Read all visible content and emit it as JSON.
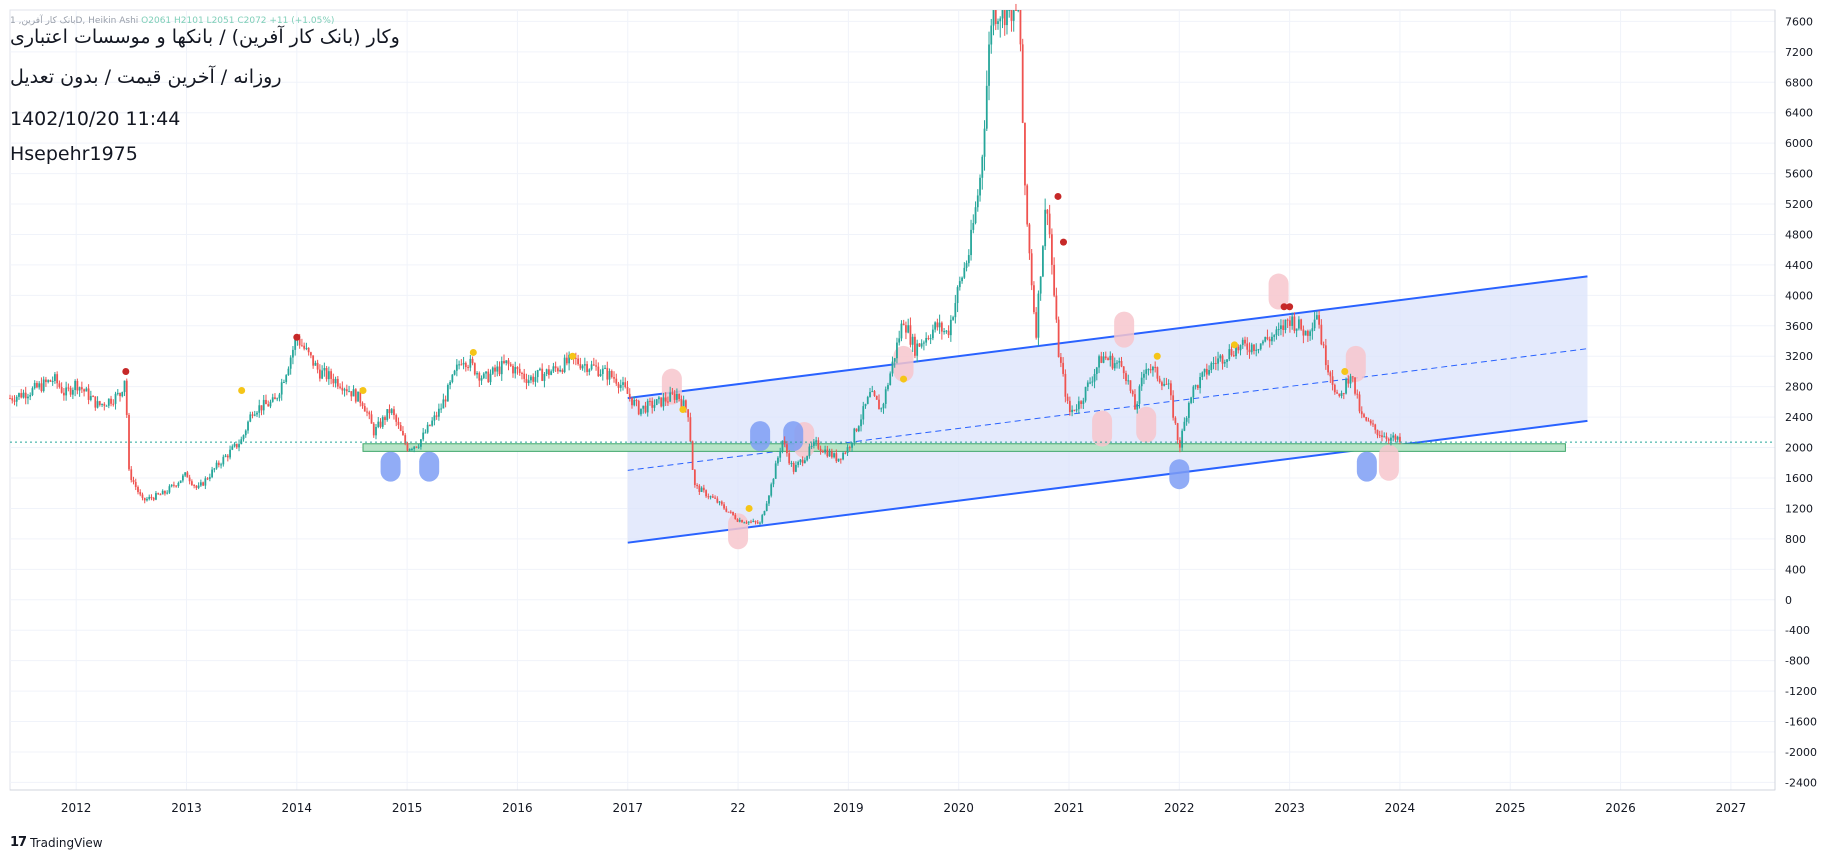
{
  "legend": {
    "symbol": "بانک کار آفرین, 1D",
    "chart_style": "Heikin Ashi",
    "ohlc": "O2061  H2101  L2051  C2072  +11 (+1.05%)"
  },
  "header": {
    "title": "وکار (بانک کار آفرین) / بانکها و موسسات اعتباری",
    "subtitle": "روزانه / آخرین قیمت / بدون تعدیل",
    "datetime": "1402/10/20 11:44",
    "author": "Hsepehr1975"
  },
  "branding": {
    "logo": "17",
    "name": "TradingView"
  },
  "colors": {
    "up": "#26a69a",
    "down": "#ef5350",
    "channel": "#2962ff",
    "channel_fill": "#dbe3fb",
    "support_fill": "#b7e4c7",
    "support_stroke": "#3fa76a",
    "blue_marker": "#7e9df5",
    "pink_marker": "#f7c5cc",
    "yellow_dot": "#f5c518",
    "red_dot": "#c62828",
    "price_line": "#26a69a",
    "grid": "#f0f3fa"
  },
  "chart_data": {
    "type": "candlestick",
    "x_tick_labels": [
      "2012",
      "2013",
      "2014",
      "2015",
      "2016",
      "2017",
      "22",
      "2019",
      "2020",
      "2021",
      "2022",
      "2023",
      "2024",
      "2025",
      "2026",
      "2027"
    ],
    "x_tick_years": [
      2012,
      2013,
      2014,
      2015,
      2016,
      2017,
      2018,
      2019,
      2020,
      2021,
      2022,
      2023,
      2024,
      2025,
      2026,
      2027
    ],
    "y_ticks": [
      7600,
      7200,
      6800,
      6400,
      6000,
      5600,
      5200,
      4800,
      4400,
      4000,
      3600,
      3200,
      2800,
      2400,
      2000,
      1600,
      1200,
      800,
      400,
      0,
      -400,
      -800,
      -1200,
      -1600,
      -2000,
      -2400
    ],
    "ylim": [
      -2500,
      7750
    ],
    "xlim": [
      2011.4,
      2027.4
    ],
    "last_price": 2072,
    "price_path": [
      [
        2011.4,
        2650
      ],
      [
        2011.6,
        2750
      ],
      [
        2011.8,
        2900
      ],
      [
        2011.9,
        2700
      ],
      [
        2012.0,
        2850
      ],
      [
        2012.2,
        2550
      ],
      [
        2012.4,
        2700
      ],
      [
        2012.45,
        2980
      ],
      [
        2012.47,
        1700
      ],
      [
        2012.6,
        1300
      ],
      [
        2012.8,
        1400
      ],
      [
        2013.0,
        1650
      ],
      [
        2013.1,
        1450
      ],
      [
        2013.3,
        1800
      ],
      [
        2013.5,
        2100
      ],
      [
        2013.6,
        2500
      ],
      [
        2013.8,
        2600
      ],
      [
        2013.9,
        3000
      ],
      [
        2014.0,
        3450
      ],
      [
        2014.2,
        3000
      ],
      [
        2014.4,
        2850
      ],
      [
        2014.6,
        2600
      ],
      [
        2014.7,
        2200
      ],
      [
        2014.85,
        2500
      ],
      [
        2015.0,
        2000
      ],
      [
        2015.1,
        2050
      ],
      [
        2015.3,
        2500
      ],
      [
        2015.5,
        3200
      ],
      [
        2015.7,
        2900
      ],
      [
        2015.9,
        3100
      ],
      [
        2016.1,
        2900
      ],
      [
        2016.3,
        3000
      ],
      [
        2016.5,
        3150
      ],
      [
        2016.7,
        3050
      ],
      [
        2016.9,
        2900
      ],
      [
        2017.1,
        2500
      ],
      [
        2017.3,
        2600
      ],
      [
        2017.45,
        2700
      ],
      [
        2017.55,
        2450
      ],
      [
        2017.6,
        1500
      ],
      [
        2017.8,
        1300
      ],
      [
        2018.0,
        1050
      ],
      [
        2018.2,
        1000
      ],
      [
        2018.3,
        1500
      ],
      [
        2018.4,
        2100
      ],
      [
        2018.5,
        1700
      ],
      [
        2018.7,
        2050
      ],
      [
        2018.9,
        1850
      ],
      [
        2019.0,
        2000
      ],
      [
        2019.2,
        2700
      ],
      [
        2019.3,
        2500
      ],
      [
        2019.4,
        3100
      ],
      [
        2019.5,
        3700
      ],
      [
        2019.6,
        3300
      ],
      [
        2019.8,
        3600
      ],
      [
        2019.9,
        3500
      ],
      [
        2020.0,
        4100
      ],
      [
        2020.1,
        4600
      ],
      [
        2020.2,
        5600
      ],
      [
        2020.3,
        7750
      ],
      [
        2020.55,
        7800
      ],
      [
        2020.6,
        5300
      ],
      [
        2020.7,
        3500
      ],
      [
        2020.75,
        4500
      ],
      [
        2020.8,
        5300
      ],
      [
        2020.9,
        3300
      ],
      [
        2021.0,
        2450
      ],
      [
        2021.1,
        2600
      ],
      [
        2021.3,
        3200
      ],
      [
        2021.5,
        3050
      ],
      [
        2021.6,
        2500
      ],
      [
        2021.7,
        3100
      ],
      [
        2021.9,
        2800
      ],
      [
        2022.0,
        2000
      ],
      [
        2022.1,
        2700
      ],
      [
        2022.3,
        3100
      ],
      [
        2022.5,
        3300
      ],
      [
        2022.7,
        3350
      ],
      [
        2022.9,
        3500
      ],
      [
        2023.0,
        3700
      ],
      [
        2023.15,
        3500
      ],
      [
        2023.25,
        3800
      ],
      [
        2023.3,
        3300
      ],
      [
        2023.45,
        2600
      ],
      [
        2023.55,
        3000
      ],
      [
        2023.65,
        2400
      ],
      [
        2023.8,
        2200
      ],
      [
        2024.0,
        2072
      ]
    ],
    "channel": {
      "upper": [
        [
          2017.0,
          2650
        ],
        [
          2025.7,
          4250
        ]
      ],
      "lower": [
        [
          2017.0,
          750
        ],
        [
          2025.7,
          2350
        ]
      ],
      "mid": [
        [
          2017.0,
          1700
        ],
        [
          2025.7,
          3300
        ]
      ]
    },
    "support_zone": {
      "x": [
        2014.6,
        2025.5
      ],
      "y": [
        1950,
        2050
      ]
    },
    "blue_markers": [
      [
        2014.85,
        1750
      ],
      [
        2015.2,
        1750
      ],
      [
        2018.2,
        2150
      ],
      [
        2018.5,
        2150
      ],
      [
        2022.0,
        1650
      ],
      [
        2023.7,
        1750
      ]
    ],
    "pink_markers": [
      [
        2017.4,
        2800
      ],
      [
        2018.0,
        900
      ],
      [
        2018.6,
        2100
      ],
      [
        2019.5,
        3100
      ],
      [
        2021.3,
        2250
      ],
      [
        2021.5,
        3550
      ],
      [
        2021.7,
        2300
      ],
      [
        2022.9,
        4050
      ],
      [
        2023.6,
        3100
      ],
      [
        2023.9,
        1800
      ]
    ],
    "yellow_dots": [
      [
        2013.5,
        2750
      ],
      [
        2014.6,
        2750
      ],
      [
        2015.6,
        3250
      ],
      [
        2016.5,
        3200
      ],
      [
        2017.5,
        2500
      ],
      [
        2018.1,
        1200
      ],
      [
        2019.5,
        2900
      ],
      [
        2021.8,
        3200
      ],
      [
        2022.5,
        3350
      ],
      [
        2023.5,
        3000
      ]
    ],
    "red_dots": [
      [
        2012.45,
        3000
      ],
      [
        2014.0,
        3450
      ],
      [
        2020.9,
        5300
      ],
      [
        2020.95,
        4700
      ],
      [
        2022.95,
        3850
      ],
      [
        2023.0,
        3850
      ]
    ]
  }
}
